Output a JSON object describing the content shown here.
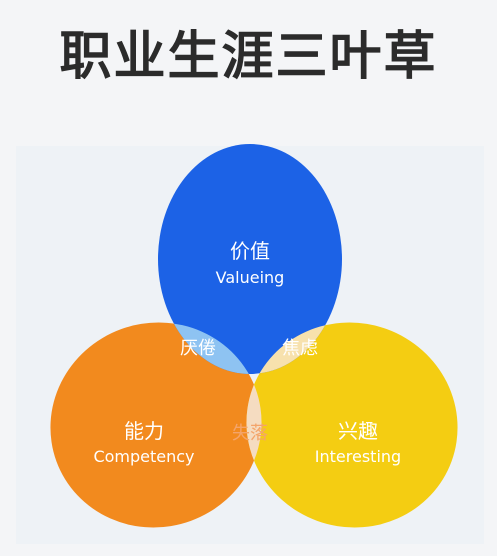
{
  "title": "职业生涯三叶草",
  "colors": {
    "valueing": "#1c62e6",
    "competency": "#f28a1e",
    "interesting": "#f4cd12",
    "overlap_blue": "#8ec3f2",
    "overlap_orange": "#f5dcc1",
    "center": "#ffffff"
  },
  "diagram": {
    "valueing": {
      "cn": "价值",
      "en": "Valueing"
    },
    "competency": {
      "cn": "能力",
      "en": "Competency"
    },
    "interesting": {
      "cn": "兴趣",
      "en": "Interesting"
    },
    "overlap_value_competency": "厌倦",
    "overlap_value_interest": "焦虑",
    "overlap_competency_interest": "失落"
  }
}
